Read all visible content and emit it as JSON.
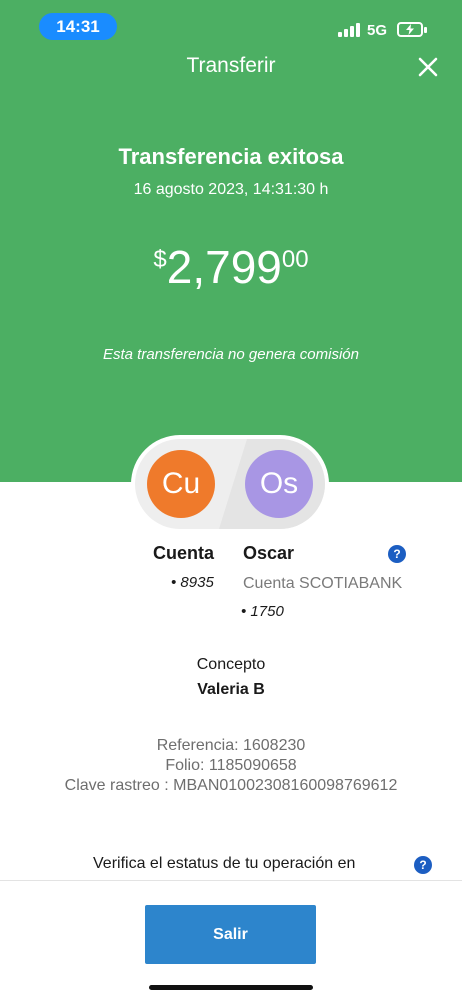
{
  "status_bar": {
    "time": "14:31",
    "network": "5G"
  },
  "header": {
    "title": "Transferir",
    "close_icon": "close-icon"
  },
  "transfer": {
    "title": "Transferencia exitosa",
    "datetime": "16 agosto 2023, 14:31:30 h",
    "amount_currency": "$",
    "amount_integer": "2,799",
    "amount_decimal": "00",
    "fee_note": "Esta transferencia no genera comisión"
  },
  "origin": {
    "initials": "Cu",
    "name": "Cuenta",
    "account": "• 8935"
  },
  "destination": {
    "initials": "Os",
    "name": "Oscar",
    "bank": "Cuenta SCOTIABANK",
    "account": "• 1750"
  },
  "concept": {
    "label": "Concepto",
    "value": "Valeria B"
  },
  "details": {
    "referencia": "Referencia: 1608230",
    "folio": "Folio: 1185090658",
    "clave_rastreo": "Clave rastreo : MBAN01002308160098769612"
  },
  "verify": {
    "text": "Verifica el estatus de tu operación en"
  },
  "actions": {
    "exit_label": "Salir"
  },
  "colors": {
    "header_green": "#4caf63",
    "button_blue": "#2d85cc",
    "origin_orange": "#ef7a2b",
    "destination_purple": "#a896e4",
    "help_blue": "#1c5ec2"
  },
  "icons": {
    "help": "question-icon",
    "signal": "signal-icon",
    "battery": "battery-charging-icon"
  }
}
